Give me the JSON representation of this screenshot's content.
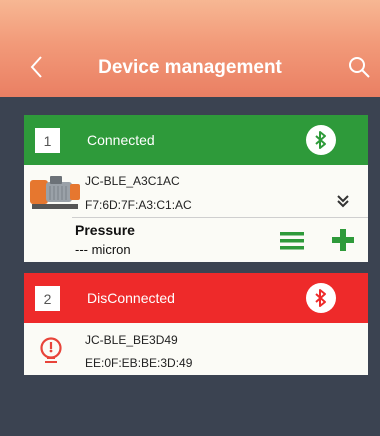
{
  "header": {
    "title": "Device management",
    "back_icon": "chevron-left-icon",
    "search_icon": "search-icon"
  },
  "colors": {
    "connected": "#2e9a3a",
    "disconnected": "#ee2a2a",
    "header_top": "#f7b793",
    "header_bottom": "#ea7f63",
    "background": "#3b4351"
  },
  "devices": [
    {
      "index": "1",
      "status": "Connected",
      "name": "JC-BLE_A3C1AC",
      "mac": "F7:6D:7F:A3:C1:AC",
      "reading_label": "Pressure",
      "reading_value": "--- micron",
      "icon": "vacuum-pump-icon"
    },
    {
      "index": "2",
      "status": "DisConnected",
      "name": "JC-BLE_BE3D49",
      "mac": "EE:0F:EB:BE:3D:49",
      "icon": "gauge-icon"
    }
  ]
}
